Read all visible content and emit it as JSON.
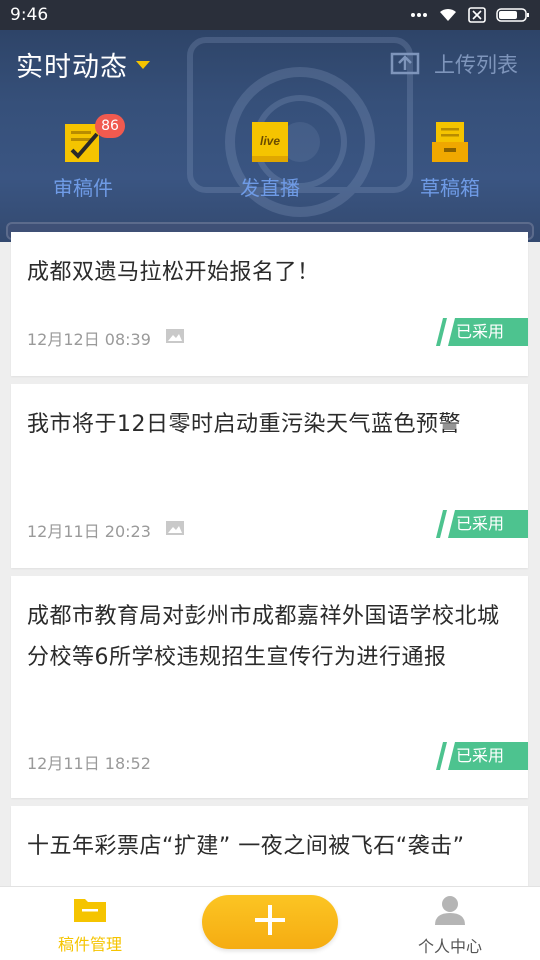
{
  "status_bar": {
    "time": "9:46"
  },
  "header": {
    "feed_title": "实时动态",
    "upload_label": "上传列表",
    "shortcuts": [
      {
        "label": "审稿件",
        "icon": "review-doc-icon",
        "badge": "86"
      },
      {
        "label": "发直播",
        "icon": "live-icon",
        "icon_text": "live"
      },
      {
        "label": "草稿箱",
        "icon": "drafts-box-icon"
      }
    ]
  },
  "articles": [
    {
      "title": "成都双遗马拉松开始报名了！",
      "time": "12月12日 08:39",
      "has_image": true,
      "status": "已采用"
    },
    {
      "title": "我市将于12日零时启动重污染天气蓝色预警",
      "time": "12月11日 20:23",
      "has_image": true,
      "status": "已采用"
    },
    {
      "title": "成都市教育局对彭州市成都嘉祥外国语学校北城分校等6所学校违规招生宣传行为进行通报",
      "time": "12月11日 18:52",
      "has_image": false,
      "status": "已采用"
    },
    {
      "title": "十五年彩票店“扩建” 一夜之间被飞石“袭击”",
      "time": "",
      "has_image": false,
      "status": ""
    }
  ],
  "bottom_nav": {
    "manage_label": "稿件管理",
    "profile_label": "个人中心"
  },
  "colors": {
    "header_bg": "#36507a",
    "accent_yellow": "#f5c400",
    "shortcut_label": "#6f9be6",
    "tag_green": "#4dc38f",
    "badge_red": "#f05a4f"
  }
}
